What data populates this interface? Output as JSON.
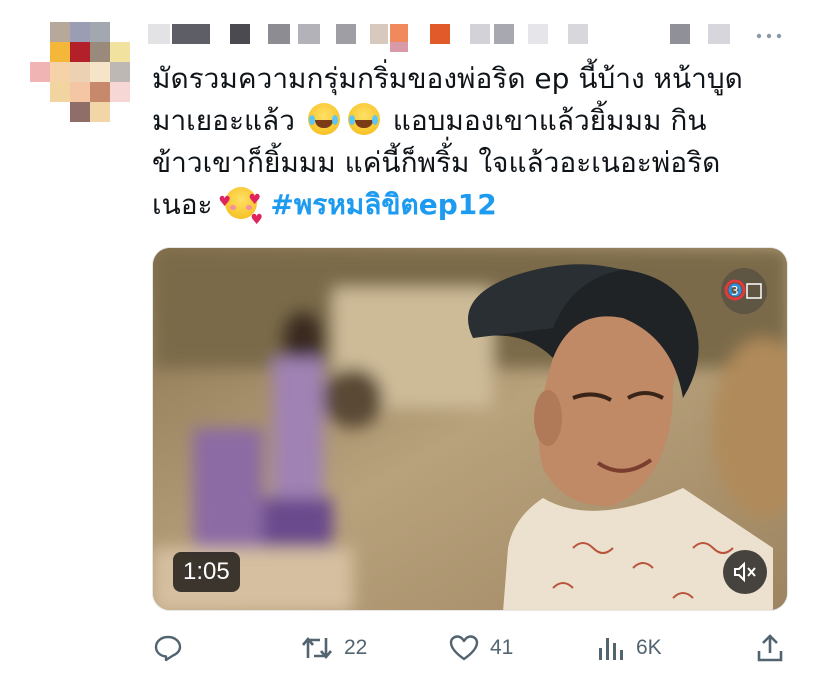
{
  "tweet": {
    "text_lines": [
      "มัดรวมความกรุ่มกริ่มของพ่อริด ep นี้บ้าง หน้าบูด",
      "มาเยอะแล้ว",
      "แอบมองเขาแล้วยิ้มมม กิน",
      "ข้าวเขาก็ยิ้มมม แค่นี้ก็พริ้่ม ใจแล้วอะเนอะพ่อริด",
      "เนอะ"
    ],
    "hashtag": "#พรหมลิขิตep12",
    "emojis": [
      "face-with-tears-of-joy",
      "face-with-tears-of-joy",
      "smiling-face-with-hearts"
    ]
  },
  "media": {
    "duration": "1:05",
    "channel_icon": "channel-3-logo",
    "mute_icon": "speaker-muted-icon"
  },
  "actions": {
    "reply": {
      "icon": "reply-icon",
      "count": ""
    },
    "retweet": {
      "icon": "retweet-icon",
      "count": "22"
    },
    "like": {
      "icon": "heart-icon",
      "count": "41"
    },
    "views": {
      "icon": "views-icon",
      "count": "6K"
    },
    "share": {
      "icon": "share-icon",
      "count": ""
    }
  },
  "more_icon": "more-icon",
  "colors": {
    "text": "#0f1419",
    "hashtag": "#1d9bf0",
    "icon": "#536471"
  }
}
